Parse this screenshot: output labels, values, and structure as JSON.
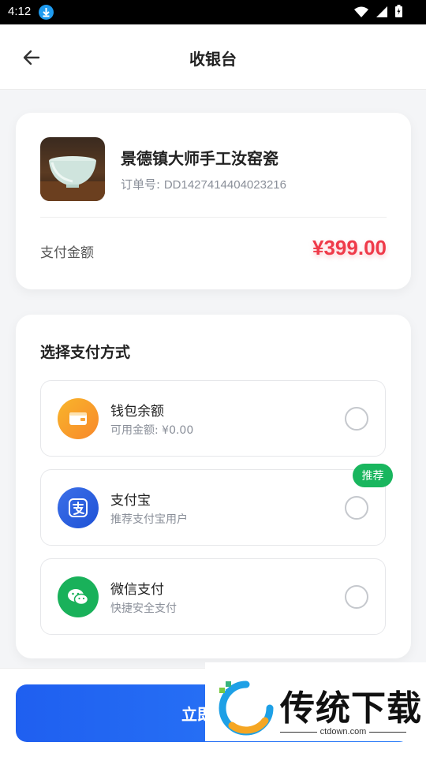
{
  "status_bar": {
    "time": "4:12"
  },
  "header": {
    "title": "收银台"
  },
  "order": {
    "product_name": "景德镇大师手工汝窑瓷",
    "order_no_label": "订单号: ",
    "order_no": "DD1427414404023216",
    "amount_label": "支付金额",
    "amount": "¥399.00"
  },
  "payment": {
    "title": "选择支付方式",
    "methods": [
      {
        "name": "钱包余额",
        "desc": "可用金额: ¥0.00",
        "icon": "wallet-icon"
      },
      {
        "name": "支付宝",
        "desc": "推荐支付宝用户",
        "icon": "alipay-icon",
        "badge": "推荐"
      },
      {
        "name": "微信支付",
        "desc": "快捷安全支付",
        "icon": "wechat-icon"
      }
    ]
  },
  "action": {
    "pay_label": "立即支付"
  },
  "watermark": {
    "title": "传统下载",
    "url": "ctdown.com"
  },
  "colors": {
    "accent": "#1f5ff0",
    "price": "#ef3b4a",
    "badge": "#19b65e"
  }
}
